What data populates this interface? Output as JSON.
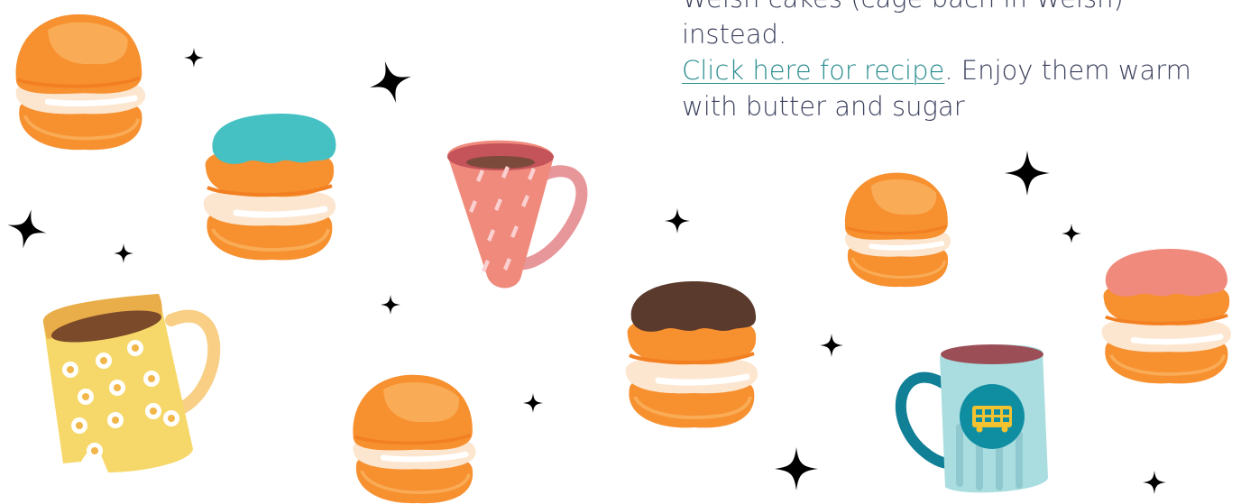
{
  "article": {
    "line1": "Welsh cakes (cage bach in Welsh) instead.",
    "link_text": "Click here for recipe",
    "after_link": ". Enjoy them warm",
    "line3": "with butter and sugar"
  },
  "colors": {
    "text": "#3a3f5c",
    "link": "#2a8c8f",
    "sparkle": "#ffd200",
    "bun": "#f7902f",
    "cream": "#fde6cf",
    "icing_teal": "#45c1c3",
    "icing_chocolate": "#5a3a2c",
    "icing_pink": "#f08a7c",
    "mug_pink": "#f08a7c",
    "mug_yellow": "#f6d86a",
    "mug_blue": "#a9dde0",
    "badge_teal": "#0f8ea2"
  },
  "illustrations": {
    "buns": [
      "plain-bun",
      "teal-iced-bun",
      "plain-bun",
      "chocolate-iced-bun",
      "plain-bun",
      "pink-iced-bun"
    ],
    "mugs": [
      "pink-dotted-mug",
      "yellow-daisy-mug",
      "blue-bus-mug"
    ],
    "decor": "sparkles"
  }
}
